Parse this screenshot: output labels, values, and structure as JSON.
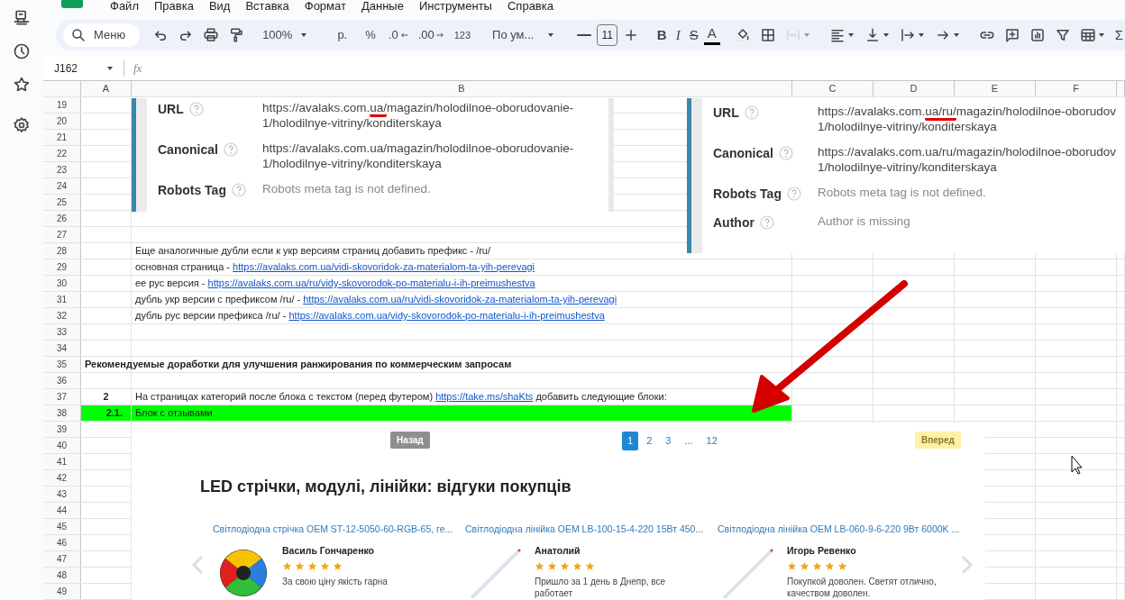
{
  "menu": [
    "Файл",
    "Правка",
    "Вид",
    "Вставка",
    "Формат",
    "Данные",
    "Инструменты",
    "Справка"
  ],
  "toolbar": {
    "search_label": "Меню",
    "zoom": "100%",
    "currency": "р.",
    "percent": "%",
    "decrease_decimals": ".0",
    "increase_decimals": ".00",
    "number_format": "123",
    "font": "По ум...",
    "font_size": "11",
    "text_format": [
      {
        "label": "B",
        "kind": "bold"
      },
      {
        "label": "I",
        "kind": "italic"
      },
      {
        "label": "S",
        "kind": "strike"
      },
      {
        "label": "A",
        "kind": "color"
      }
    ],
    "merge_cells": {
      "disabled": true
    },
    "sum": "Σ"
  },
  "formula_bar": {
    "cell_ref": "J162",
    "fx": "fx"
  },
  "columns": [
    "A",
    "B",
    "C",
    "D",
    "E",
    "F"
  ],
  "rows": [
    {
      "number": "19"
    },
    {
      "number": "20"
    },
    {
      "number": "21"
    },
    {
      "number": "22"
    },
    {
      "number": "23"
    },
    {
      "number": "24"
    },
    {
      "number": "25"
    },
    {
      "number": "26"
    },
    {
      "number": "27"
    },
    {
      "number": "28",
      "b": {
        "text": "Еще аналогичные дубли если к укр версиям страниц добавить префикс - /ru/"
      }
    },
    {
      "number": "29",
      "b": {
        "text": "основная страница - ",
        "link": "https://avalaks.com.ua/vidi-skovoridok-za-materialom-ta-yih-perevagi"
      }
    },
    {
      "number": "30",
      "b": {
        "text": "ее рус версия - ",
        "link": "https://avalaks.com.ua/ru/vidy-skovorodok-po-materialu-i-ih-preimushestva"
      }
    },
    {
      "number": "31",
      "b": {
        "text": "дубль укр версии с префиксом /ru/ - ",
        "link": "https://avalaks.com.ua/ru/vidi-skovoridok-za-materialom-ta-yih-perevagi"
      }
    },
    {
      "number": "32",
      "b": {
        "text": "дубль рус версии префикса /ru/ - ",
        "link": "https://avalaks.com.ua/vidy-skovorodok-po-materialu-i-ih-preimushestva"
      }
    },
    {
      "number": "33"
    },
    {
      "number": "34"
    },
    {
      "number": "35",
      "a": {
        "text": "Рекомендуемые доработки для улучшения ранжирования по коммерческим запросам",
        "kind": "heading"
      }
    },
    {
      "number": "36"
    },
    {
      "number": "37",
      "a": {
        "text": "2",
        "kind": "index"
      },
      "b": {
        "text": "На страницах категорий после блока с текстом (перед футером) ",
        "link": "https://take.ms/shaKts",
        "suffix": " добавить следующие блоки:"
      }
    },
    {
      "number": "38",
      "highlighted": true,
      "a": {
        "text": "2.1.",
        "kind": "subindex"
      },
      "b": {
        "text": "Блок с отзывами"
      }
    },
    {
      "number": "39"
    },
    {
      "number": "40"
    },
    {
      "number": "41"
    },
    {
      "number": "42"
    },
    {
      "number": "43"
    },
    {
      "number": "44"
    },
    {
      "number": "45"
    },
    {
      "number": "46"
    },
    {
      "number": "47"
    },
    {
      "number": "48"
    },
    {
      "number": "49"
    }
  ],
  "screenshots": [
    {
      "fields": [
        {
          "label": "URL",
          "lines": [
            [
              {
                "text": "https://avalaks.com."
              },
              {
                "text": "ua/",
                "marked": true
              },
              {
                "text": "magazin/holodilnoe-oborudovanie-"
              }
            ],
            [
              {
                "text": "1/holodilnye-vitriny/konditerskaya"
              }
            ]
          ]
        },
        {
          "label": "Canonical",
          "lines": [
            [
              {
                "text": "https://avalaks.com.ua/magazin/holodilnoe-oborudovanie-"
              }
            ],
            [
              {
                "text": "1/holodilnye-vitriny/konditerskaya"
              }
            ]
          ]
        },
        {
          "label": "Robots Tag",
          "muted": true,
          "lines": [
            [
              {
                "text": "Robots meta tag is not defined."
              }
            ]
          ]
        }
      ]
    },
    {
      "fields": [
        {
          "label": "URL",
          "lines": [
            [
              {
                "text": "https://avalaks.com."
              },
              {
                "text": "ua/ru/",
                "marked": true
              },
              {
                "text": "magazin/holodilnoe-oborudov"
              }
            ],
            [
              {
                "text": "1/holodilnye-vitriny/konditerskaya"
              }
            ]
          ]
        },
        {
          "label": "Canonical",
          "lines": [
            [
              {
                "text": "https://avalaks.com.ua/ru/magazin/holodilnoe-oborudov"
              }
            ],
            [
              {
                "text": "1/holodilnye-vitriny/konditerskaya"
              }
            ]
          ]
        },
        {
          "label": "Robots Tag",
          "muted": true,
          "lines": [
            [
              {
                "text": "Robots meta tag is not defined."
              }
            ]
          ]
        },
        {
          "label": "Author",
          "muted": true,
          "lines": [
            [
              {
                "text": "Author is missing"
              }
            ]
          ]
        }
      ]
    }
  ],
  "reviews_block": {
    "prev": {
      "label": "Назад",
      "disabled": true
    },
    "pages": [
      {
        "label": "1",
        "selected": true
      },
      {
        "label": "2",
        "selected": false
      },
      {
        "label": "3",
        "selected": false
      },
      {
        "label": "...",
        "selected": false
      },
      {
        "label": "12",
        "selected": false
      }
    ],
    "next": {
      "label": "Вперед",
      "disabled": false
    },
    "heading": "LED стрічки, модулі, лінійки: відгуки покупців",
    "reviews": [
      {
        "product": "Світлодіодна стрічка OEM ST-12-5050-60-RGB-65, ге...",
        "kind": "strip",
        "author": "Василь Гончаренко",
        "stars": 5,
        "text": "За свою ціну якість гарна"
      },
      {
        "product": "Світлодіодна лінійка OEM LB-100-15-4-220 15Вт 450...",
        "kind": "tube",
        "author": "Анатолий",
        "stars": 5,
        "text": "Пришло за 1 день в Днепр, все работает"
      },
      {
        "product": "Світлодіодна лінійка OEM LB-060-9-6-220 9Вт 6000K ...",
        "kind": "tube",
        "author": "Игорь Ревенко",
        "stars": 5,
        "text": "Покупкой доволен. Светят отлично, качеством доволен."
      }
    ]
  }
}
